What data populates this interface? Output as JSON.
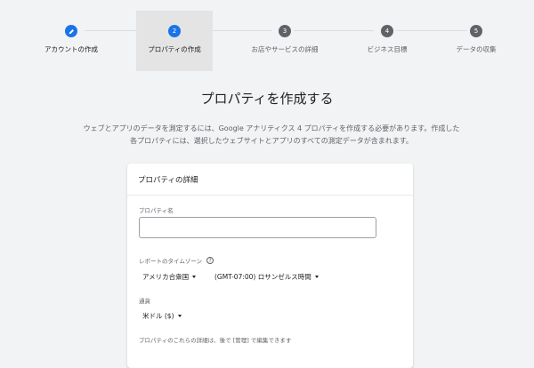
{
  "stepper": {
    "steps": [
      {
        "number": "",
        "label": "アカウントの作成"
      },
      {
        "number": "2",
        "label": "プロパティの作成"
      },
      {
        "number": "3",
        "label": "お店やサービスの詳細"
      },
      {
        "number": "4",
        "label": "ビジネス目標"
      },
      {
        "number": "5",
        "label": "データの収集"
      }
    ]
  },
  "page": {
    "title": "プロパティを作成する",
    "description": "ウェブとアプリのデータを測定するには、Google アナリティクス 4 プロパティを作成する必要があります。作成した各プロパティには、選択したウェブサイトとアプリのすべての測定データが含まれます。"
  },
  "card": {
    "header": "プロパティの詳細",
    "property_name_label": "プロパティ名",
    "property_name_value": "",
    "timezone_label": "レポートのタイムゾーン",
    "country_value": "アメリカ合衆国",
    "timezone_value": "(GMT-07:00) ロサンゼルス時間",
    "currency_label": "通貨",
    "currency_value": "米ドル ($)",
    "footer_note": "プロパティのこれらの詳細は、後で [管理] で編集できます"
  }
}
